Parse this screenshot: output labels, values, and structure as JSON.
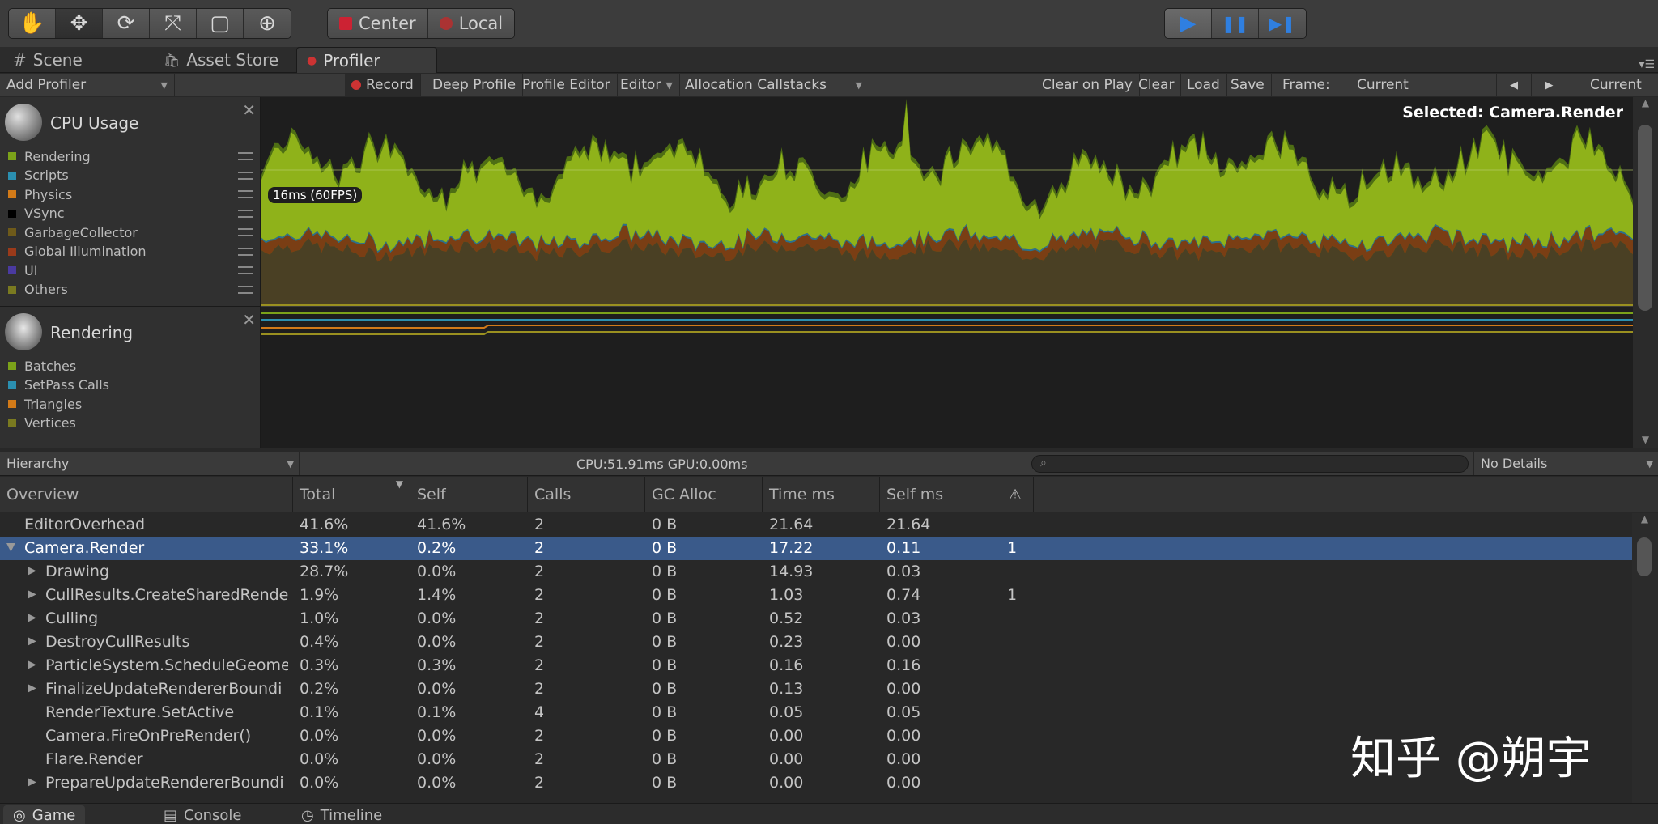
{
  "toolbar": {
    "tools": [
      {
        "name": "hand-tool",
        "glyph": "✋"
      },
      {
        "name": "move-tool",
        "glyph": "✥"
      },
      {
        "name": "rotate-tool",
        "glyph": "⟳"
      },
      {
        "name": "scale-tool",
        "glyph": "⤧"
      },
      {
        "name": "rect-tool",
        "glyph": "▢"
      },
      {
        "name": "transform-tool",
        "glyph": "⊕"
      }
    ],
    "pivot_label": "Center",
    "space_label": "Local",
    "play_glyph": "▶",
    "pause_glyph": "❚❚",
    "step_glyph": "▶❚"
  },
  "tabs": [
    {
      "label": "Scene",
      "glyph": "#"
    },
    {
      "label": "Asset Store",
      "glyph": "🛍"
    },
    {
      "label": "Profiler",
      "glyph": "●"
    }
  ],
  "profiler_toolbar": {
    "add_profiler": "Add Profiler",
    "record": "Record",
    "deep_profile": "Deep Profile",
    "profile_editor": "Profile Editor",
    "editor": "Editor",
    "allocation_callstacks": "Allocation Callstacks",
    "clear_on_play": "Clear on Play",
    "clear": "Clear",
    "load": "Load",
    "save": "Save",
    "frame_label": "Frame:",
    "frame_value": "Current",
    "prev_glyph": "◀",
    "next_glyph": "▶",
    "current": "Current"
  },
  "cpu_module": {
    "title": "CPU Usage",
    "close": "✕",
    "legend": [
      {
        "label": "Rendering",
        "color": "#7ba21a"
      },
      {
        "label": "Scripts",
        "color": "#2b8fb0"
      },
      {
        "label": "Physics",
        "color": "#d27a18"
      },
      {
        "label": "VSync",
        "color": "#000000"
      },
      {
        "label": "GarbageCollector",
        "color": "#6e5a1a"
      },
      {
        "label": "Global Illumination",
        "color": "#9a3a1a"
      },
      {
        "label": "UI",
        "color": "#4a3aa0"
      },
      {
        "label": "Others",
        "color": "#7a7a20"
      }
    ],
    "selected": "Selected: Camera.Render",
    "fps_label": "16ms (60FPS)"
  },
  "rendering_module": {
    "title": "Rendering",
    "close": "✕",
    "legend": [
      {
        "label": "Batches",
        "color": "#7ba21a"
      },
      {
        "label": "SetPass Calls",
        "color": "#2b8fb0"
      },
      {
        "label": "Triangles",
        "color": "#d27a18"
      },
      {
        "label": "Vertices",
        "color": "#7a7a20"
      }
    ]
  },
  "hierarchy_bar": {
    "mode": "Hierarchy",
    "cpu_gpu": "CPU:51.91ms   GPU:0.00ms",
    "search_glyph": "⌕",
    "details": "No Details"
  },
  "table": {
    "headers": [
      "Overview",
      "Total",
      "Self",
      "Calls",
      "GC Alloc",
      "Time ms",
      "Self ms"
    ],
    "sort_glyph": "▼",
    "warn_glyph": "⚠",
    "rows": [
      {
        "name": "EditorOverhead",
        "total": "41.6%",
        "self": "41.6%",
        "calls": "2",
        "gc": "0 B",
        "time": "21.64",
        "selfms": "21.64",
        "warn": "",
        "depth": 0,
        "expand": ""
      },
      {
        "name": "Camera.Render",
        "total": "33.1%",
        "self": "0.2%",
        "calls": "2",
        "gc": "0 B",
        "time": "17.22",
        "selfms": "0.11",
        "warn": "1",
        "depth": 0,
        "expand": "▼",
        "selected": true
      },
      {
        "name": "Drawing",
        "total": "28.7%",
        "self": "0.0%",
        "calls": "2",
        "gc": "0 B",
        "time": "14.93",
        "selfms": "0.03",
        "warn": "",
        "depth": 1,
        "expand": "▶"
      },
      {
        "name": "CullResults.CreateSharedRende",
        "total": "1.9%",
        "self": "1.4%",
        "calls": "2",
        "gc": "0 B",
        "time": "1.03",
        "selfms": "0.74",
        "warn": "1",
        "depth": 1,
        "expand": "▶"
      },
      {
        "name": "Culling",
        "total": "1.0%",
        "self": "0.0%",
        "calls": "2",
        "gc": "0 B",
        "time": "0.52",
        "selfms": "0.03",
        "warn": "",
        "depth": 1,
        "expand": "▶"
      },
      {
        "name": "DestroyCullResults",
        "total": "0.4%",
        "self": "0.0%",
        "calls": "2",
        "gc": "0 B",
        "time": "0.23",
        "selfms": "0.00",
        "warn": "",
        "depth": 1,
        "expand": "▶"
      },
      {
        "name": "ParticleSystem.ScheduleGeome",
        "total": "0.3%",
        "self": "0.3%",
        "calls": "2",
        "gc": "0 B",
        "time": "0.16",
        "selfms": "0.16",
        "warn": "",
        "depth": 1,
        "expand": "▶"
      },
      {
        "name": "FinalizeUpdateRendererBoundi",
        "total": "0.2%",
        "self": "0.0%",
        "calls": "2",
        "gc": "0 B",
        "time": "0.13",
        "selfms": "0.00",
        "warn": "",
        "depth": 1,
        "expand": "▶"
      },
      {
        "name": "RenderTexture.SetActive",
        "total": "0.1%",
        "self": "0.1%",
        "calls": "4",
        "gc": "0 B",
        "time": "0.05",
        "selfms": "0.05",
        "warn": "",
        "depth": 1,
        "expand": ""
      },
      {
        "name": "Camera.FireOnPreRender()",
        "total": "0.0%",
        "self": "0.0%",
        "calls": "2",
        "gc": "0 B",
        "time": "0.00",
        "selfms": "0.00",
        "warn": "",
        "depth": 1,
        "expand": ""
      },
      {
        "name": "Flare.Render",
        "total": "0.0%",
        "self": "0.0%",
        "calls": "2",
        "gc": "0 B",
        "time": "0.00",
        "selfms": "0.00",
        "warn": "",
        "depth": 1,
        "expand": ""
      },
      {
        "name": "PrepareUpdateRendererBoundi",
        "total": "0.0%",
        "self": "0.0%",
        "calls": "2",
        "gc": "0 B",
        "time": "0.00",
        "selfms": "0.00",
        "warn": "",
        "depth": 1,
        "expand": "▶"
      }
    ]
  },
  "bottom_tabs": [
    {
      "label": "Game",
      "glyph": "◎"
    },
    {
      "label": "Console",
      "glyph": "▤"
    },
    {
      "label": "Timeline",
      "glyph": "◷"
    }
  ],
  "watermark": "知乎 @朔宇"
}
